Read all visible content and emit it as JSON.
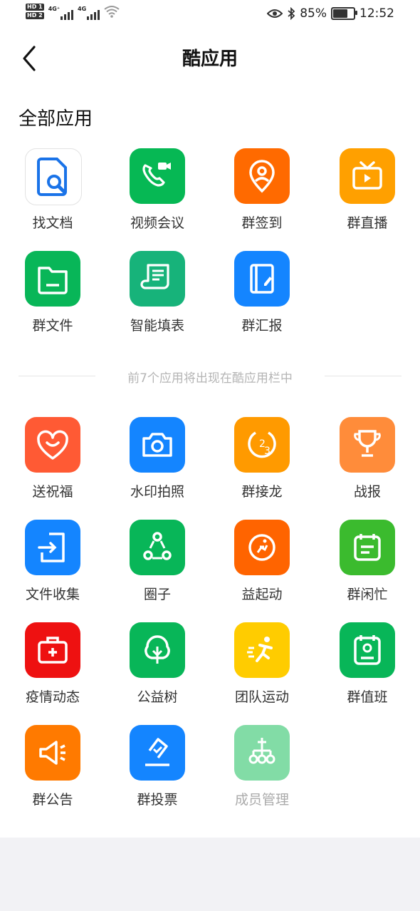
{
  "status_bar": {
    "sim1": "HD 1",
    "sim2": "HD 2",
    "net1": "4G⁺",
    "net2": "4G",
    "battery_percent": "85%",
    "battery_level": 0.85,
    "time": "12:52"
  },
  "header": {
    "title": "酷应用"
  },
  "section_title": "全部应用",
  "top_apps": [
    {
      "label": "找文档",
      "icon": "doc-search-icon",
      "color": "#ffffff"
    },
    {
      "label": "视频会议",
      "icon": "video-call-icon",
      "color": "#06b854"
    },
    {
      "label": "群签到",
      "icon": "location-pin-icon",
      "color": "#ff6a00"
    },
    {
      "label": "群直播",
      "icon": "tv-live-icon",
      "color": "#ffa000"
    },
    {
      "label": "群文件",
      "icon": "folder-icon",
      "color": "#08b658"
    },
    {
      "label": "智能填表",
      "icon": "form-scroll-icon",
      "color": "#17b37a"
    },
    {
      "label": "群汇报",
      "icon": "report-book-icon",
      "color": "#1485ff"
    }
  ],
  "divider_text": "前7个应用将出现在酷应用栏中",
  "more_apps": [
    {
      "label": "送祝福",
      "icon": "heart-smile-icon",
      "color": "#ff5a34"
    },
    {
      "label": "水印拍照",
      "icon": "camera-icon",
      "color": "#1485ff"
    },
    {
      "label": "群接龙",
      "icon": "relay-123-icon",
      "color": "#ff9a00"
    },
    {
      "label": "战报",
      "icon": "trophy-icon",
      "color": "#ff8c3a"
    },
    {
      "label": "文件收集",
      "icon": "file-collect-icon",
      "color": "#1485ff"
    },
    {
      "label": "圈子",
      "icon": "circle-group-icon",
      "color": "#08b658"
    },
    {
      "label": "益起动",
      "icon": "runner-circle-icon",
      "color": "#ff6400"
    },
    {
      "label": "群闲忙",
      "icon": "calendar-status-icon",
      "color": "#3bbb2e"
    },
    {
      "label": "疫情动态",
      "icon": "medical-kit-icon",
      "color": "#ee1111"
    },
    {
      "label": "公益树",
      "icon": "tree-icon",
      "color": "#08b658"
    },
    {
      "label": "团队运动",
      "icon": "sprint-icon",
      "color": "#ffcc00"
    },
    {
      "label": "群值班",
      "icon": "duty-badge-icon",
      "color": "#08b658"
    },
    {
      "label": "群公告",
      "icon": "megaphone-icon",
      "color": "#ff7a00"
    },
    {
      "label": "群投票",
      "icon": "vote-box-icon",
      "color": "#1485ff"
    },
    {
      "label": "成员管理",
      "icon": "org-tree-icon",
      "color": "#82dca6",
      "disabled": true
    }
  ]
}
